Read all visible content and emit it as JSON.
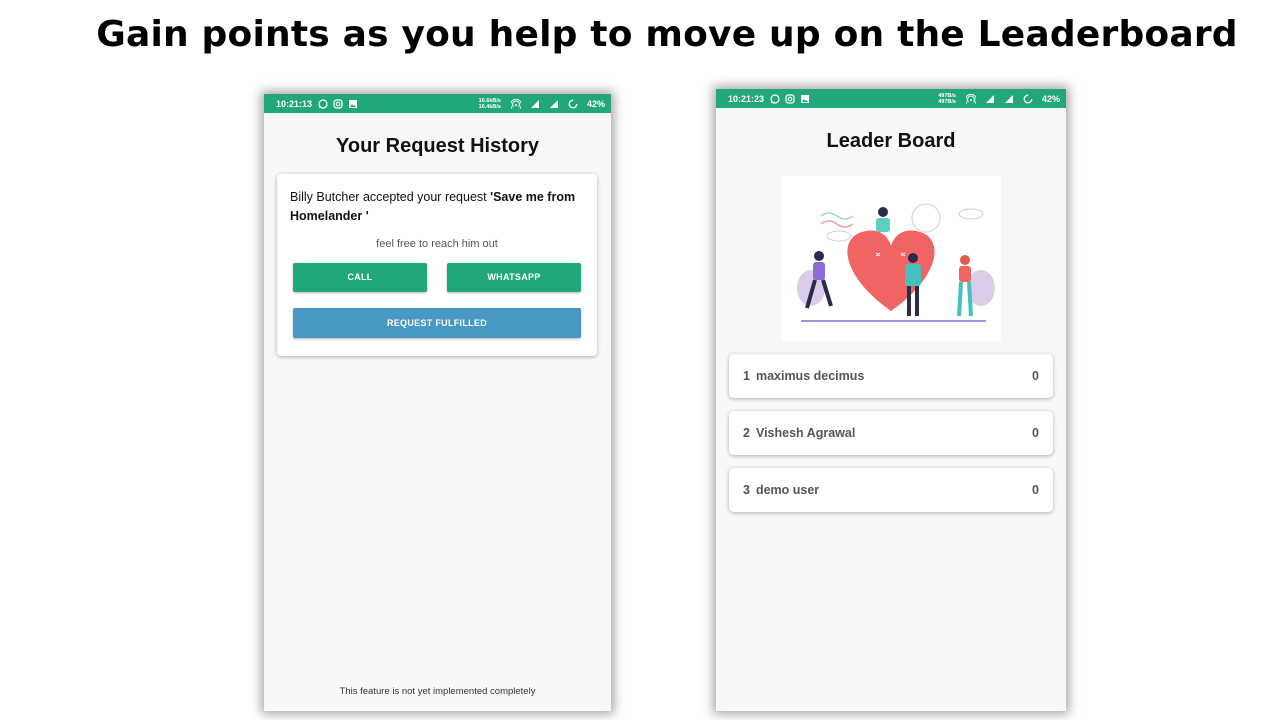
{
  "slide": {
    "title": "Gain points as you help to move up on the Leaderboard"
  },
  "left_phone": {
    "status_bar": {
      "time": "10:21:13",
      "net_up": "16.6kB/s",
      "net_down": "16.4kB/s",
      "battery": "42%",
      "icons": [
        "whatsapp-icon",
        "instagram-icon",
        "image-icon",
        "hotspot-icon",
        "4g-signal-icon",
        "signal-icon",
        "battery-saver-icon"
      ]
    },
    "title": "Your Request History",
    "card": {
      "text_prefix": "Billy Butcher accepted your request ",
      "text_request": "'Save me from Homelander '",
      "reach_text": "feel free to reach him out",
      "call_label": "CALL",
      "whatsapp_label": "WHATSAPP",
      "fulfilled_label": "REQUEST FULFILLED"
    },
    "footer_note": "This feature is not yet implemented completely",
    "colors": {
      "accent": "#22a878",
      "fulfilled": "#4799c4"
    }
  },
  "right_phone": {
    "status_bar": {
      "time": "10:21:23",
      "net_up": "497B/s",
      "net_down": "497B/s",
      "battery": "42%",
      "icons": [
        "whatsapp-icon",
        "instagram-icon",
        "image-icon",
        "hotspot-icon",
        "4g-signal-icon",
        "signal-icon",
        "battery-saver-icon"
      ]
    },
    "title": "Leader Board",
    "illustration": "people-with-heart-illustration",
    "leaderboard": [
      {
        "rank": "1",
        "name": "maximus decimus",
        "points": "0"
      },
      {
        "rank": "2",
        "name": "Vishesh Agrawal",
        "points": "0"
      },
      {
        "rank": "3",
        "name": "demo user",
        "points": "0"
      }
    ]
  }
}
